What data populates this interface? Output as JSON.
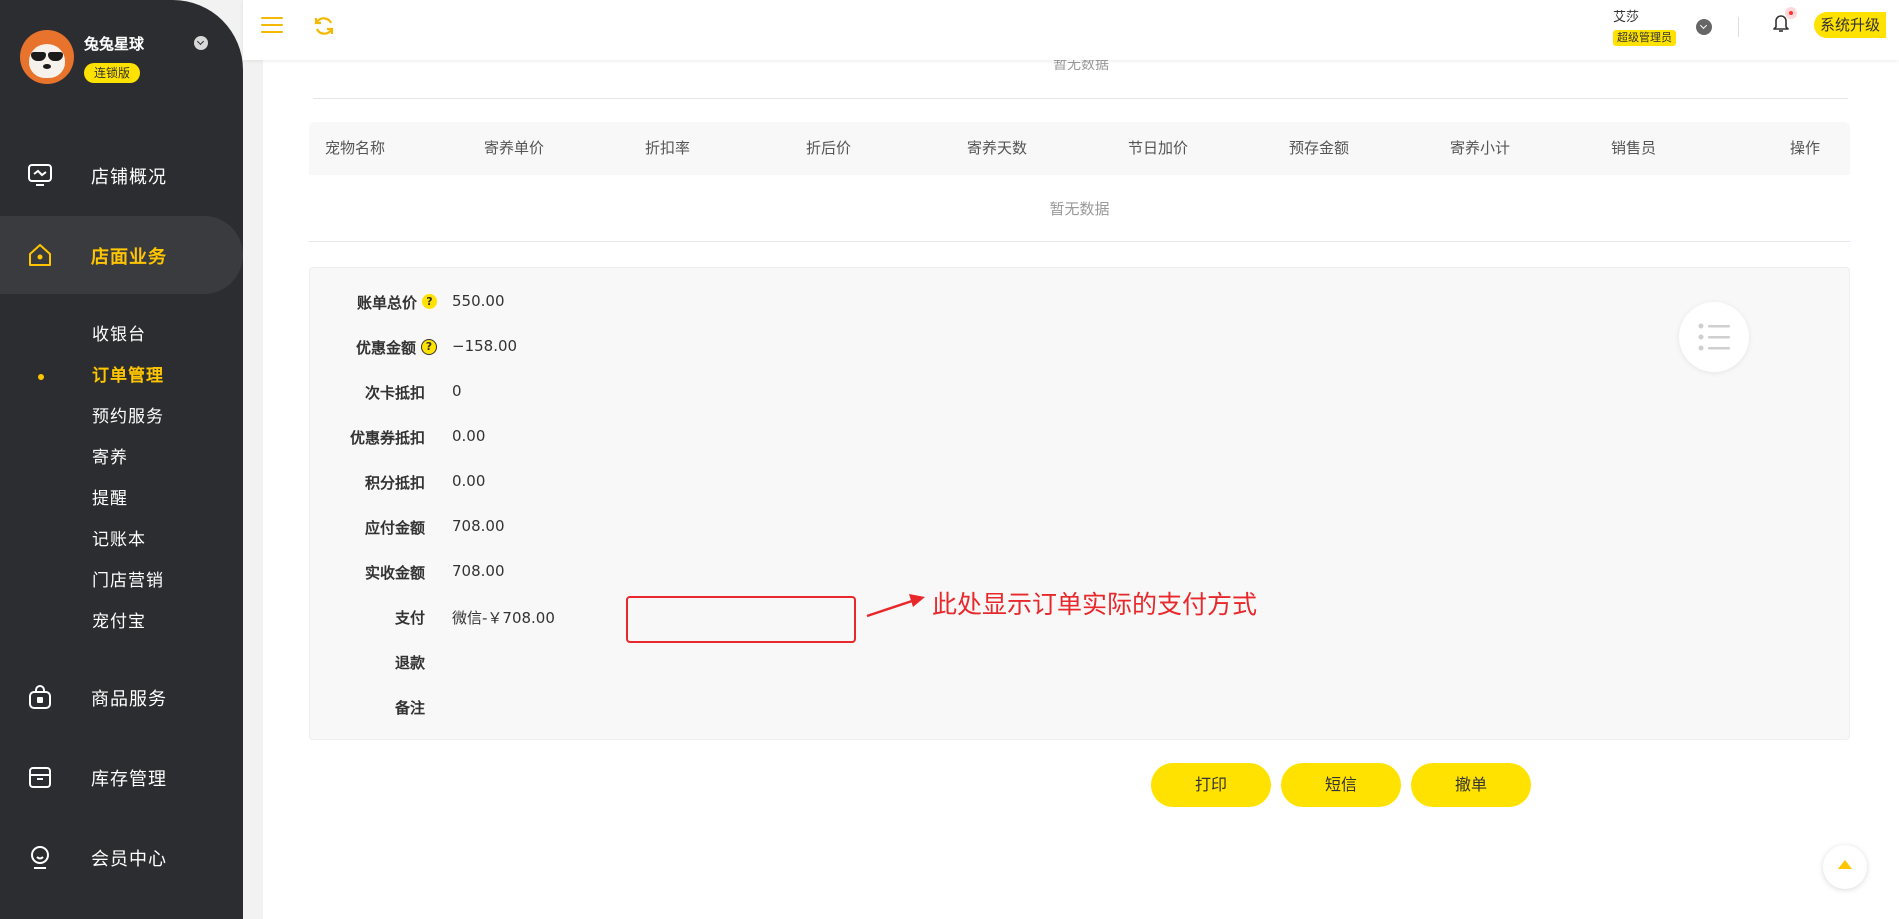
{
  "sidebar": {
    "store_name": "兔兔星球",
    "edition": "连锁版",
    "nav": [
      {
        "label": "店铺概况",
        "icon": "monitor-icon"
      },
      {
        "label": "店面业务",
        "icon": "home-icon"
      },
      {
        "label": "商品服务",
        "icon": "bag-icon"
      },
      {
        "label": "库存管理",
        "icon": "box-icon"
      },
      {
        "label": "会员中心",
        "icon": "member-icon"
      }
    ],
    "sub_items": [
      "收银台",
      "订单管理",
      "预约服务",
      "寄养",
      "提醒",
      "记账本",
      "门店营销",
      "宠付宝"
    ],
    "active_nav": "店面业务",
    "active_sub": "订单管理"
  },
  "header": {
    "user_name": "艾莎",
    "role": "超级管理员",
    "upgrade_label": "系统升级"
  },
  "content": {
    "empty_text_top": "暂无数据",
    "table": {
      "columns": [
        "宠物名称",
        "寄养单价",
        "折扣率",
        "折后价",
        "寄养天数",
        "节日加价",
        "预存金额",
        "寄养小计",
        "销售员",
        "操作"
      ],
      "empty_text": "暂无数据"
    },
    "summary": {
      "total_label": "账单总价",
      "total_value": "550.00",
      "discount_label": "优惠金额",
      "discount_value": "−158.00",
      "card_label": "次卡抵扣",
      "card_value": "0",
      "coupon_label": "优惠券抵扣",
      "coupon_value": "0.00",
      "points_label": "积分抵扣",
      "points_value": "0.00",
      "payable_label": "应付金额",
      "payable_value": "708.00",
      "received_label": "实收金额",
      "received_value": "708.00",
      "pay_label": "支付",
      "pay_value": "微信-￥708.00",
      "refund_label": "退款",
      "remark_label": "备注"
    },
    "annotation": "此处显示订单实际的支付方式",
    "actions": {
      "print": "打印",
      "sms": "短信",
      "cancel": "撤单"
    }
  },
  "colors": {
    "accent": "#ffe200",
    "sidebar_bg": "#2c2d30",
    "active_text": "#ffc500",
    "annotation": "#e8282a"
  }
}
